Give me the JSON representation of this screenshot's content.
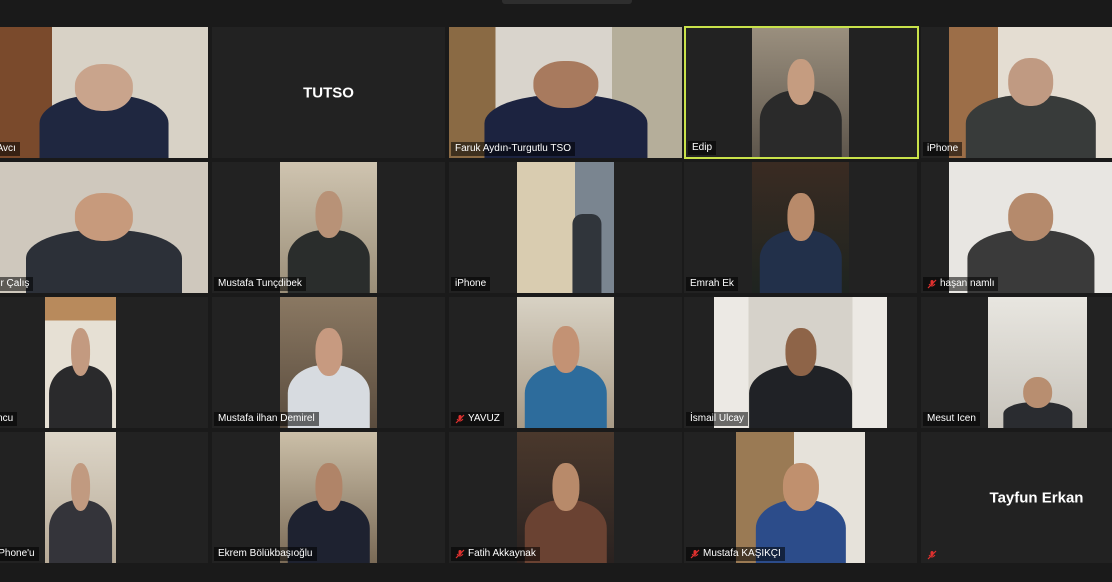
{
  "participants": [
    {
      "name": "zat Avcı",
      "video": true,
      "muted": false
    },
    {
      "name": "TUTSO",
      "video": false,
      "muted": false
    },
    {
      "name": "Faruk Aydın-Turgutlu TSO",
      "video": true,
      "muted": false
    },
    {
      "name": "Edip",
      "video": true,
      "muted": false,
      "active": true
    },
    {
      "name": "iPhone",
      "video": true,
      "muted": false
    },
    {
      "name": "amer Çalış",
      "video": true,
      "muted": false
    },
    {
      "name": "Mustafa Tunçdibek",
      "video": true,
      "muted": false
    },
    {
      "name": "iPhone",
      "video": true,
      "muted": false
    },
    {
      "name": "Emrah Ek",
      "video": true,
      "muted": false
    },
    {
      "name": "haşan namlı",
      "video": true,
      "muted": true
    },
    {
      "name": "oyuncu",
      "video": true,
      "muted": false
    },
    {
      "name": "Mustafa ilhan Demirel",
      "video": true,
      "muted": false
    },
    {
      "name": "YAVUZ",
      "video": true,
      "muted": true
    },
    {
      "name": "İsmail Ulcay",
      "video": true,
      "muted": false
    },
    {
      "name": "Mesut Icen",
      "video": true,
      "muted": false
    },
    {
      "name": "Pa iPhone'u",
      "video": true,
      "muted": false
    },
    {
      "name": "Ekrem Bölükbaşıoğlu",
      "video": true,
      "muted": false
    },
    {
      "name": "Fatih Akkaynak",
      "video": true,
      "muted": true
    },
    {
      "name": "Mustafa KAŞIKÇI",
      "video": true,
      "muted": true
    },
    {
      "name": "Tayfun Erkan",
      "video": false,
      "muted": true
    }
  ],
  "colors": {
    "active_border": "#c9e24a",
    "tile_bg": "#222222",
    "mute_red": "#e0312f"
  }
}
